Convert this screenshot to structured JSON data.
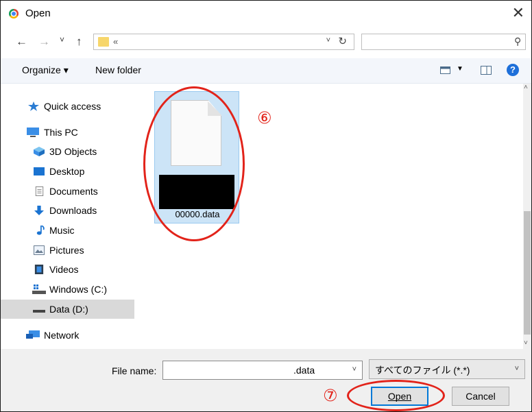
{
  "window": {
    "title": "Open",
    "close_glyph": "✕"
  },
  "navbar": {
    "back_glyph": "←",
    "forward_glyph": "→",
    "recent_glyph": "˅",
    "up_glyph": "↑",
    "breadcrumb": "«",
    "address_dropdown_glyph": "˅",
    "refresh_glyph": "↻",
    "search_placeholder": "",
    "search_glyph": "⚲"
  },
  "toolbar": {
    "organize_label": "Organize ▾",
    "new_folder_label": "New folder",
    "view_dropdown_glyph": "▼",
    "help_glyph": "?"
  },
  "sidebar": {
    "items": [
      {
        "label": "Quick access",
        "icon": "star-icon"
      },
      {
        "label": "This PC",
        "icon": "computer-icon"
      },
      {
        "label": "3D Objects",
        "icon": "cube-icon"
      },
      {
        "label": "Desktop",
        "icon": "desktop-icon"
      },
      {
        "label": "Documents",
        "icon": "document-icon"
      },
      {
        "label": "Downloads",
        "icon": "download-arrow-icon"
      },
      {
        "label": "Music",
        "icon": "music-note-icon"
      },
      {
        "label": "Pictures",
        "icon": "picture-icon"
      },
      {
        "label": "Videos",
        "icon": "film-icon"
      },
      {
        "label": "Windows (C:)",
        "icon": "windows-drive-icon"
      },
      {
        "label": "Data (D:)",
        "icon": "drive-icon",
        "selected": true
      },
      {
        "label": "Network",
        "icon": "network-icon"
      }
    ]
  },
  "content": {
    "file": {
      "name": "00000.data",
      "icon": "blank-file-icon"
    }
  },
  "annotations": {
    "step6": "⑥",
    "step7": "⑦",
    "ring_color": "#e2231a"
  },
  "bottom": {
    "file_name_label": "File name:",
    "file_name_value": ".data",
    "file_type_value": "すべてのファイル (*.*)",
    "dropdown_glyph": "˅",
    "open_label": "Open",
    "cancel_label": "Cancel"
  },
  "scrollbar": {
    "up_glyph": "˄",
    "down_glyph": "˅"
  },
  "colors": {
    "accent": "#0078d7",
    "selection": "#cce4f7",
    "annotation_red": "#e2231a"
  }
}
